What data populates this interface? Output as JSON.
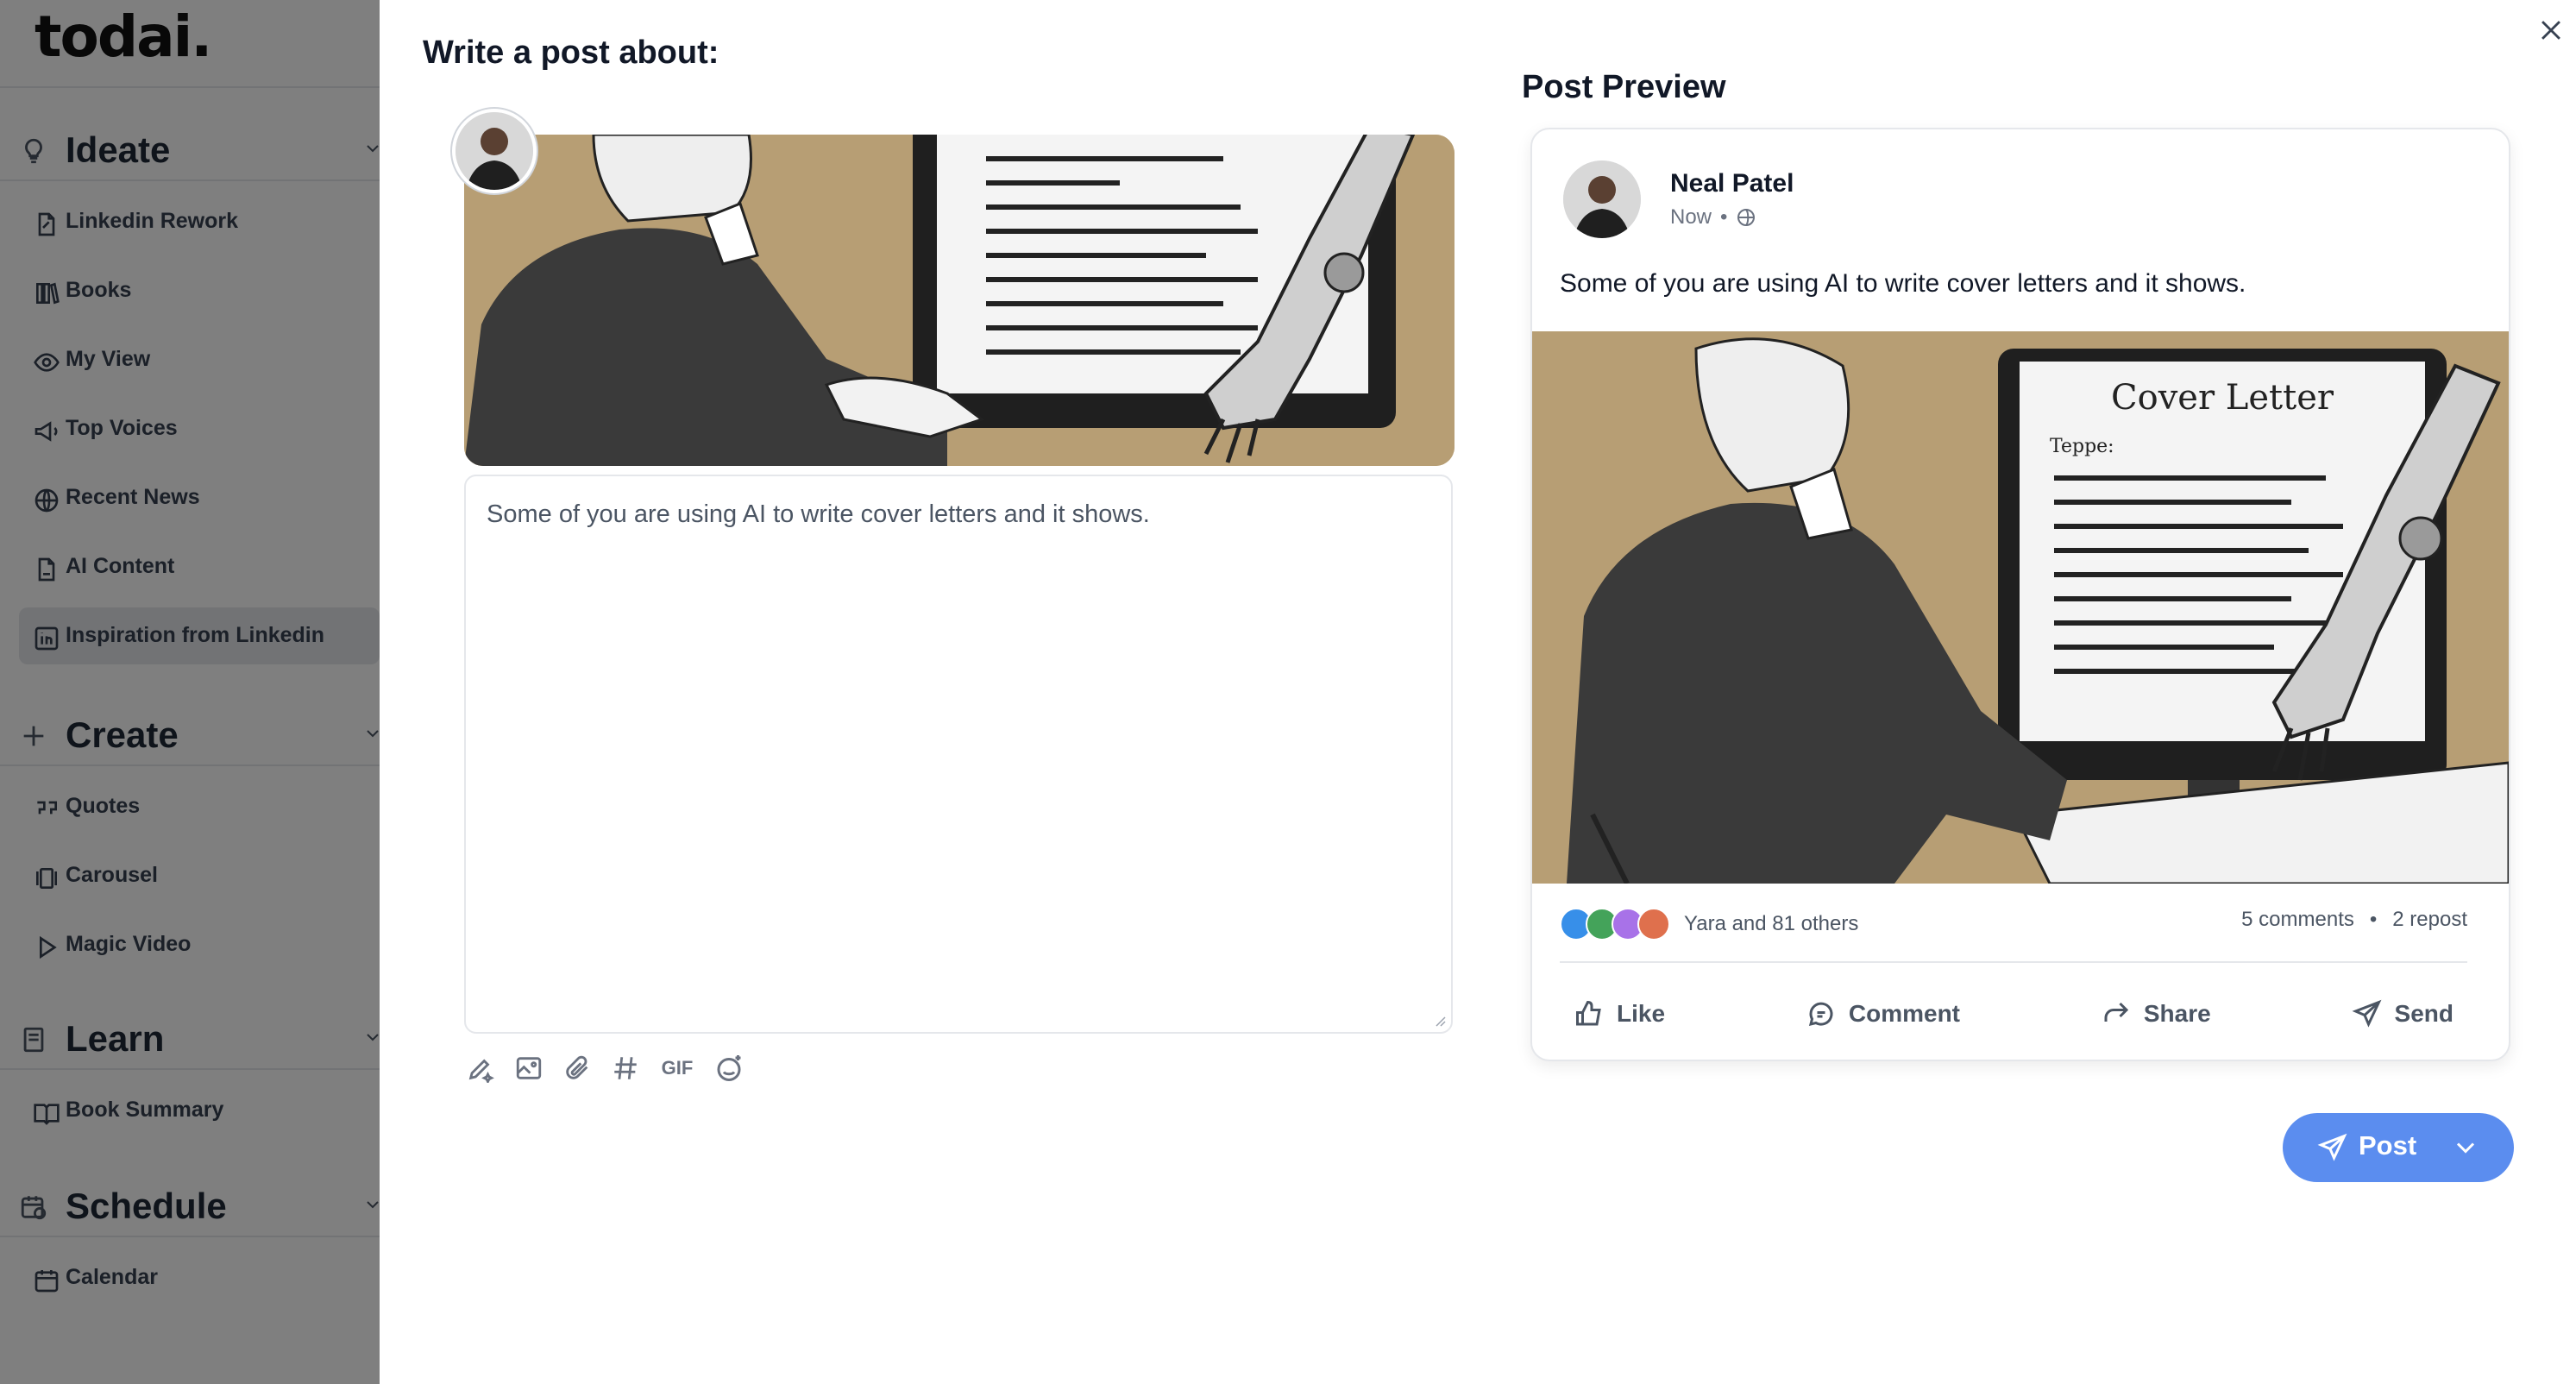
{
  "app": {
    "logo": "todai."
  },
  "sidebar": {
    "sections": [
      {
        "title": "Ideate",
        "icon": "lightbulb-icon"
      },
      {
        "title": "Create",
        "icon": "plus-icon"
      },
      {
        "title": "Learn",
        "icon": "book-icon"
      },
      {
        "title": "Schedule",
        "icon": "calendar-clock-icon"
      }
    ],
    "ideate_items": [
      {
        "label": "Linkedin Rework",
        "icon": "document-edit-icon"
      },
      {
        "label": "Books",
        "icon": "books-icon"
      },
      {
        "label": "My View",
        "icon": "eye-icon"
      },
      {
        "label": "Top Voices",
        "icon": "megaphone-icon"
      },
      {
        "label": "Recent News",
        "icon": "globe-icon"
      },
      {
        "label": "AI Content",
        "icon": "ai-document-icon"
      },
      {
        "label": "Inspiration from Linkedin",
        "icon": "linkedin-icon"
      }
    ],
    "create_items": [
      {
        "label": "Quotes",
        "icon": "quote-icon"
      },
      {
        "label": "Carousel",
        "icon": "carousel-icon"
      },
      {
        "label": "Magic Video",
        "icon": "play-icon"
      }
    ],
    "learn_items": [
      {
        "label": "Book Summary",
        "icon": "open-book-icon"
      }
    ],
    "schedule_items": [
      {
        "label": "Calendar",
        "icon": "calendar-icon"
      }
    ]
  },
  "modal": {
    "heading": "Write a post about:",
    "editor_text": "Some of you are using AI to write cover letters and it shows.",
    "toolbar": {
      "gif_label": "GIF"
    },
    "preview_heading": "Post Preview",
    "preview": {
      "author": "Neal Patel",
      "time": "Now",
      "text": "Some of you are using AI to write cover letters and it shows.",
      "image_heading": "Cover Letter",
      "image_subtext": "Teppe:",
      "reactions_text": "Yara and 81 others",
      "comments": "5 comments",
      "reposts": "2 repost",
      "actions": {
        "like": "Like",
        "comment": "Comment",
        "share": "Share",
        "send": "Send"
      }
    },
    "post_button": "Post"
  },
  "colors": {
    "accent": "#5b8def",
    "image_bg": "#b79e74",
    "overlay": "rgba(0,0,0,0.5)"
  }
}
